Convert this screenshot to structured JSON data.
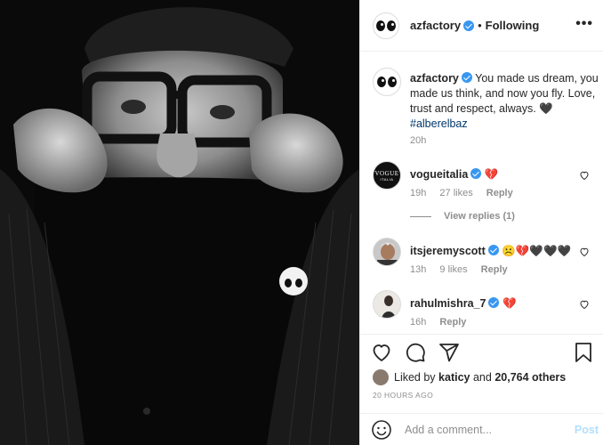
{
  "header": {
    "username": "azfactory",
    "separator": "•",
    "follow_status": "Following",
    "more_icon": "more-horizontal-icon",
    "more_glyph": "•••"
  },
  "caption": {
    "username": "azfactory",
    "text": "You made us dream, you made us think, and now you fly. Love, trust and respect, always. 🖤",
    "hashtag": "#alberelbaz",
    "time": "20h"
  },
  "comments": [
    {
      "username": "vogueitalia",
      "text": "💔",
      "time": "19h",
      "likes": "27 likes",
      "reply": "Reply",
      "avatar_top": "VOGUE",
      "avatar_bottom": "ITALIA"
    },
    {
      "username": "itsjeremyscott",
      "text": "☹️💔🖤🖤🖤",
      "time": "13h",
      "likes": "9 likes",
      "reply": "Reply"
    },
    {
      "username": "rahulmishra_7",
      "text": "💔",
      "time": "16h",
      "likes": "",
      "reply": "Reply"
    }
  ],
  "view_replies": "View replies (1)",
  "actions": {
    "like_icon": "heart-icon",
    "comment_icon": "comment-icon",
    "share_icon": "share-icon",
    "save_icon": "bookmark-icon"
  },
  "likes": {
    "prefix": "Liked by",
    "user": "katicy",
    "middle": "and",
    "count": "20,764 others"
  },
  "timestamp": "20 HOURS AGO",
  "comment_input": {
    "placeholder": "Add a comment...",
    "post_label": "Post",
    "emoji_icon": "emoji-icon"
  },
  "colors": {
    "verified": "#3897f0",
    "link": "#00376b",
    "muted": "#8e8e8e",
    "post_disabled": "#b2dffc"
  }
}
